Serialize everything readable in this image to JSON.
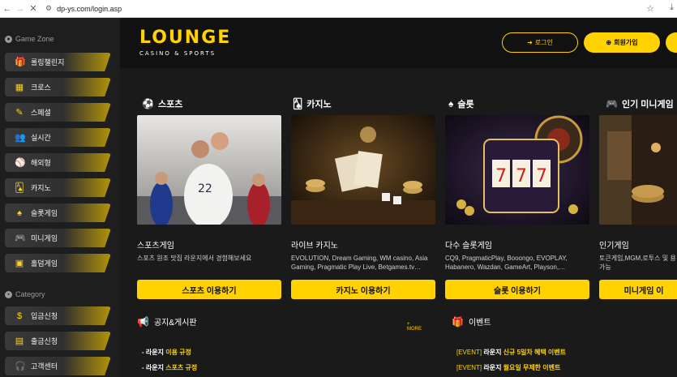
{
  "browser": {
    "url": "dp-ys.com/login.asp"
  },
  "sidebar": {
    "section1": "Game Zone",
    "items": [
      {
        "label": "롤링챌린지",
        "icon": "gift-icon"
      },
      {
        "label": "크로스",
        "icon": "grid-icon"
      },
      {
        "label": "스페셜",
        "icon": "pen-icon"
      },
      {
        "label": "실시간",
        "icon": "people-icon"
      },
      {
        "label": "해외형",
        "icon": "basketball-icon"
      },
      {
        "label": "카지노",
        "icon": "cards-icon"
      },
      {
        "label": "슬롯게임",
        "icon": "spade-icon"
      },
      {
        "label": "미니게임",
        "icon": "gamepad-icon"
      },
      {
        "label": "홀덤게임",
        "icon": "holdem-icon"
      }
    ],
    "section2": "Category",
    "items2": [
      {
        "label": "입금신청",
        "icon": "deposit-icon"
      },
      {
        "label": "출금신청",
        "icon": "withdraw-icon"
      },
      {
        "label": "고객센터",
        "icon": "headset-icon"
      }
    ]
  },
  "header": {
    "logo_main": "LOUNGE",
    "logo_sub": "CASINO & SPORTS",
    "login_label": "로그인",
    "join_label": "회원가입"
  },
  "cards": [
    {
      "heading": "스포츠",
      "title": "스포츠게임",
      "desc": "스포츠 원조 맛집 라운지에서 경험해보세요",
      "button": "스포츠 이용하기"
    },
    {
      "heading": "카지노",
      "title": "라이브 카지노",
      "desc": "EVOLUTION, Dream Gaming, WM casino, Asia Gaming, Pragmatic Play Live, Betgames.tv…",
      "button": "카지노 이용하기"
    },
    {
      "heading": "슬롯",
      "title": "다수 슬롯게임",
      "desc": "CQ9, PragmaticPlay, Booongo, EVOPLAY, Habanero, Wazdan, GameArt, Playson,…",
      "button": "슬롯 이용하기"
    },
    {
      "heading": "인기 미니게임",
      "title": "인기게임",
      "desc": "토큰게임,MGM,로투스 및 용가능",
      "button": "미니게임 이"
    }
  ],
  "notice": {
    "title": "공지&게시판",
    "more": "+ MORE",
    "items": [
      {
        "prefix": "- 라운지 ",
        "highlight": "이용 규정"
      },
      {
        "prefix": "- 라운지 ",
        "highlight": "스포츠 규정"
      }
    ]
  },
  "event": {
    "title": "이벤트",
    "items": [
      {
        "tag": "[EVENT] ",
        "prefix": "라운지 ",
        "highlight": "신규 5일차 혜택 이벤트"
      },
      {
        "tag": "[EVENT] ",
        "prefix": "라운지 ",
        "highlight": "월요일 무제한 이벤트"
      }
    ]
  },
  "colors": {
    "accent": "#ffd200",
    "background": "#1a1a1a"
  }
}
